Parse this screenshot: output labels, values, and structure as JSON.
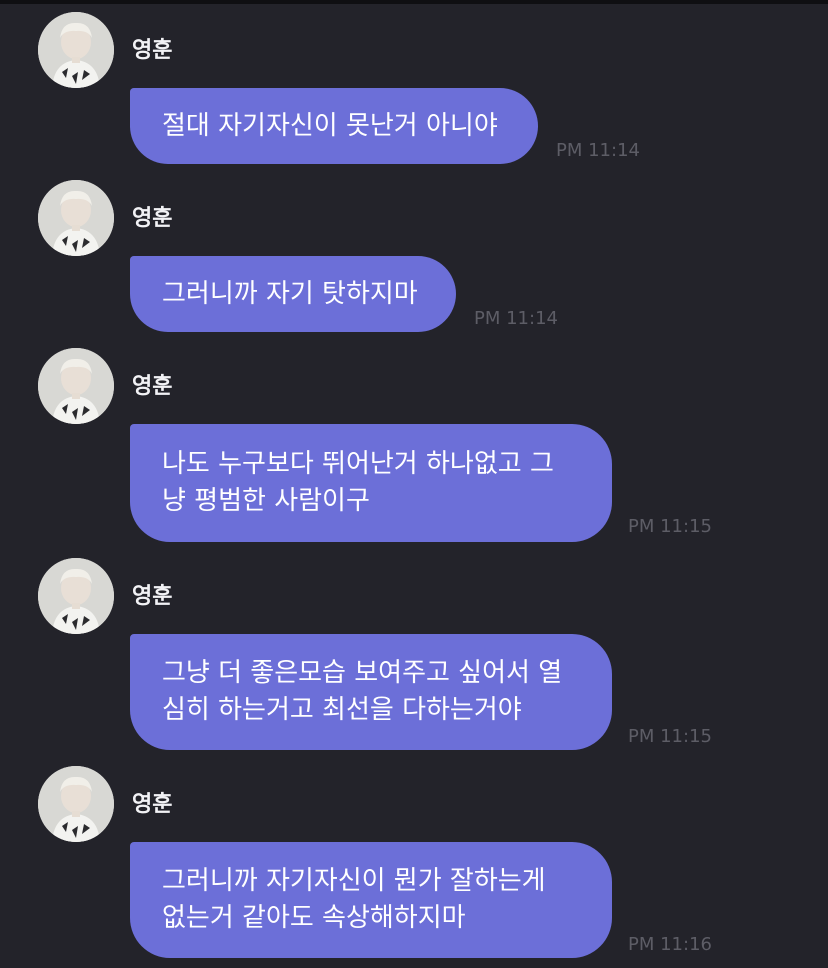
{
  "chat": {
    "messages": [
      {
        "sender": "영훈",
        "lines": [
          "절대 자기자신이 못난거 아니야"
        ],
        "time": "PM 11:14"
      },
      {
        "sender": "영훈",
        "lines": [
          "그러니까 자기 탓하지마"
        ],
        "time": "PM 11:14"
      },
      {
        "sender": "영훈",
        "lines": [
          "나도 누구보다 뛰어난거 하나없고 그",
          "냥 평범한 사람이구"
        ],
        "time": "PM 11:15"
      },
      {
        "sender": "영훈",
        "lines": [
          "그냥 더 좋은모습 보여주고 싶어서 열",
          "심히 하는거고 최선을 다하는거야"
        ],
        "time": "PM 11:15"
      },
      {
        "sender": "영훈",
        "lines": [
          "그러니까 자기자신이 뭔가 잘하는게",
          "없는거 같아도 속상해하지마"
        ],
        "time": "PM 11:16"
      }
    ]
  },
  "colors": {
    "background": "#23232a",
    "bubble": "#6c6fd8",
    "timestamp": "#5d5d66"
  },
  "icons": {
    "avatar": "profile-photo"
  }
}
